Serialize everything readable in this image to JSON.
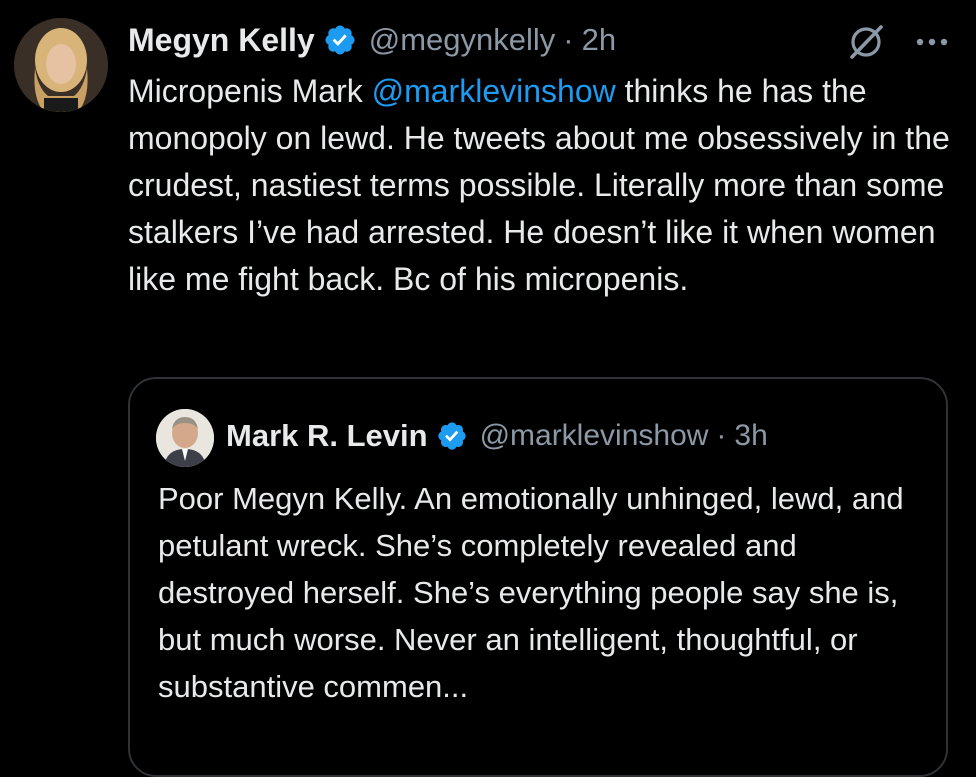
{
  "tweet": {
    "author": {
      "display_name": "Megyn Kelly",
      "handle": "@megynkelly",
      "time": "2h",
      "verified_icon": "verified-badge-icon",
      "verified_color": "#1d9bf0"
    },
    "text": {
      "part1": "Micropenis Mark ",
      "mention": "@marklevinshow",
      "part2": " thinks he has the monopoly on lewd. He tweets about me obsessively in the crudest, nastiest terms possible. Literally more than some stalkers I’ve had arrested. He doesn’t like it when women like me fight back. Bc of his micropenis."
    },
    "separator": "·",
    "actions": {
      "grok_icon": "grok-icon",
      "more_icon": "more-options-icon"
    }
  },
  "quote": {
    "author": {
      "display_name": "Mark R. Levin",
      "handle": "@marklevinshow",
      "time": "3h",
      "verified_icon": "verified-badge-icon"
    },
    "separator": "·",
    "text": "Poor Megyn Kelly.  An emotionally unhinged, lewd, and petulant wreck.  She’s completely revealed and destroyed herself. She’s everything people say she is, but much worse.  Never an intelligent, thoughtful, or substantive commen..."
  },
  "colors": {
    "background": "#000000",
    "text_primary": "#e7e9ea",
    "text_secondary": "#8b98a5",
    "link": "#1d9bf0",
    "border": "#2f3336"
  }
}
